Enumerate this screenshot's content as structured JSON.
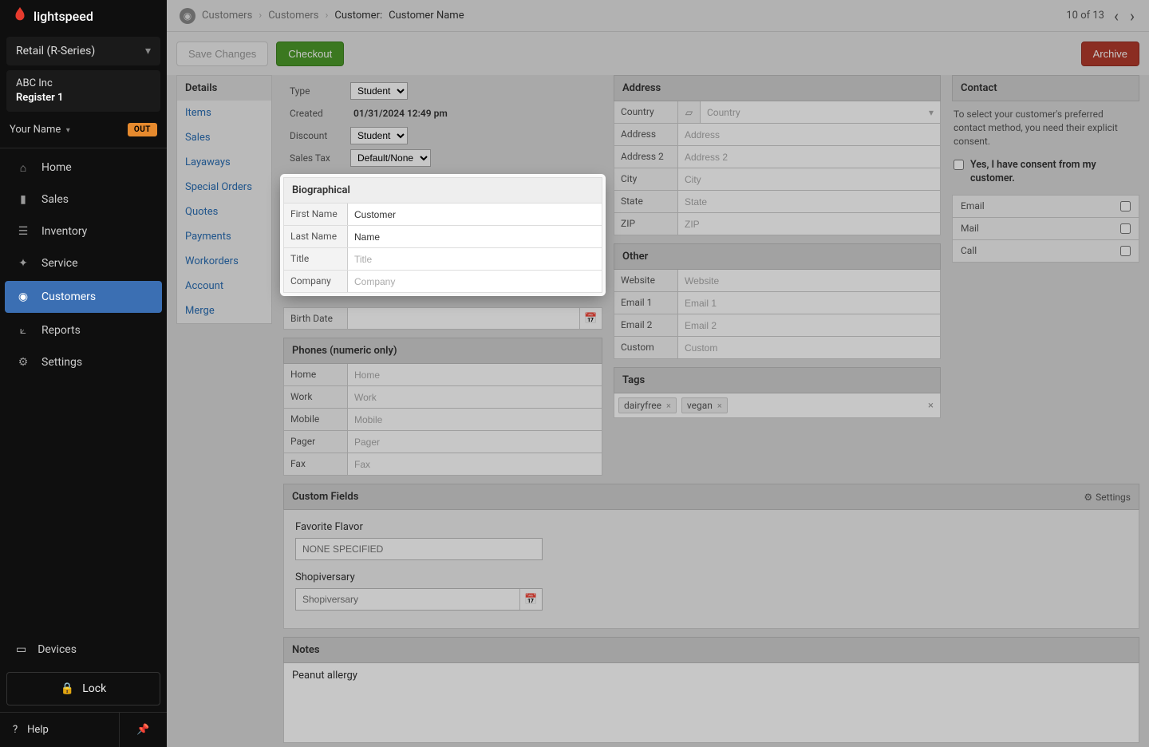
{
  "brand": "lightspeed",
  "retail_label": "Retail (R-Series)",
  "company": {
    "name": "ABC Inc",
    "register": "Register 1"
  },
  "user": {
    "name": "Your Name",
    "out": "OUT"
  },
  "nav": [
    "Home",
    "Sales",
    "Inventory",
    "Service",
    "Customers",
    "Reports",
    "Settings"
  ],
  "devices": "Devices",
  "lock": "Lock",
  "help": "Help",
  "crumbs": {
    "c1": "Customers",
    "c2": "Customers",
    "c3": "Customer:",
    "c4": "Customer Name"
  },
  "pager": {
    "label": "10 of 13"
  },
  "toolbar": {
    "save": "Save Changes",
    "checkout": "Checkout",
    "archive": "Archive"
  },
  "sidetabs": [
    "Details",
    "Items",
    "Sales",
    "Layaways",
    "Special Orders",
    "Quotes",
    "Payments",
    "Workorders",
    "Account",
    "Merge"
  ],
  "top_fields": {
    "type_label": "Type",
    "type_value": "Student",
    "created_label": "Created",
    "created_value": "01/31/2024 12:49 pm",
    "discount_label": "Discount",
    "discount_value": "Student",
    "salestax_label": "Sales Tax",
    "salestax_value": "Default/None"
  },
  "bio": {
    "head": "Biographical",
    "first_label": "First Name",
    "first_value": "Customer",
    "last_label": "Last Name",
    "last_value": "Name",
    "title_label": "Title",
    "title_placeholder": "Title",
    "company_label": "Company",
    "company_placeholder": "Company"
  },
  "birth": {
    "label": "Birth Date"
  },
  "phones": {
    "head": "Phones (numeric only)",
    "home": "Home",
    "work": "Work",
    "mobile": "Mobile",
    "pager": "Pager",
    "fax": "Fax"
  },
  "address": {
    "head": "Address",
    "country_label": "Country",
    "country_placeholder": "Country",
    "addr_label": "Address",
    "addr_placeholder": "Address",
    "addr2_label": "Address 2",
    "addr2_placeholder": "Address 2",
    "city_label": "City",
    "city_placeholder": "City",
    "state_label": "State",
    "state_placeholder": "State",
    "zip_label": "ZIP",
    "zip_placeholder": "ZIP"
  },
  "other": {
    "head": "Other",
    "website_label": "Website",
    "website_placeholder": "Website",
    "email1_label": "Email 1",
    "email1_placeholder": "Email 1",
    "email2_label": "Email 2",
    "email2_placeholder": "Email 2",
    "custom_label": "Custom",
    "custom_placeholder": "Custom"
  },
  "tags": {
    "head": "Tags",
    "t1": "dairyfree",
    "t2": "vegan"
  },
  "contact": {
    "head": "Contact",
    "text": "To select your customer's preferred contact method, you need their explicit consent.",
    "consent": "Yes, I have consent from my customer.",
    "email": "Email",
    "mail": "Mail",
    "call": "Call"
  },
  "custom_fields": {
    "head": "Custom Fields",
    "settings": "Settings",
    "fav_label": "Favorite Flavor",
    "fav_placeholder": "NONE SPECIFIED",
    "shop_label": "Shopiversary",
    "shop_placeholder": "Shopiversary"
  },
  "notes": {
    "head": "Notes",
    "text": "Peanut allergy"
  }
}
